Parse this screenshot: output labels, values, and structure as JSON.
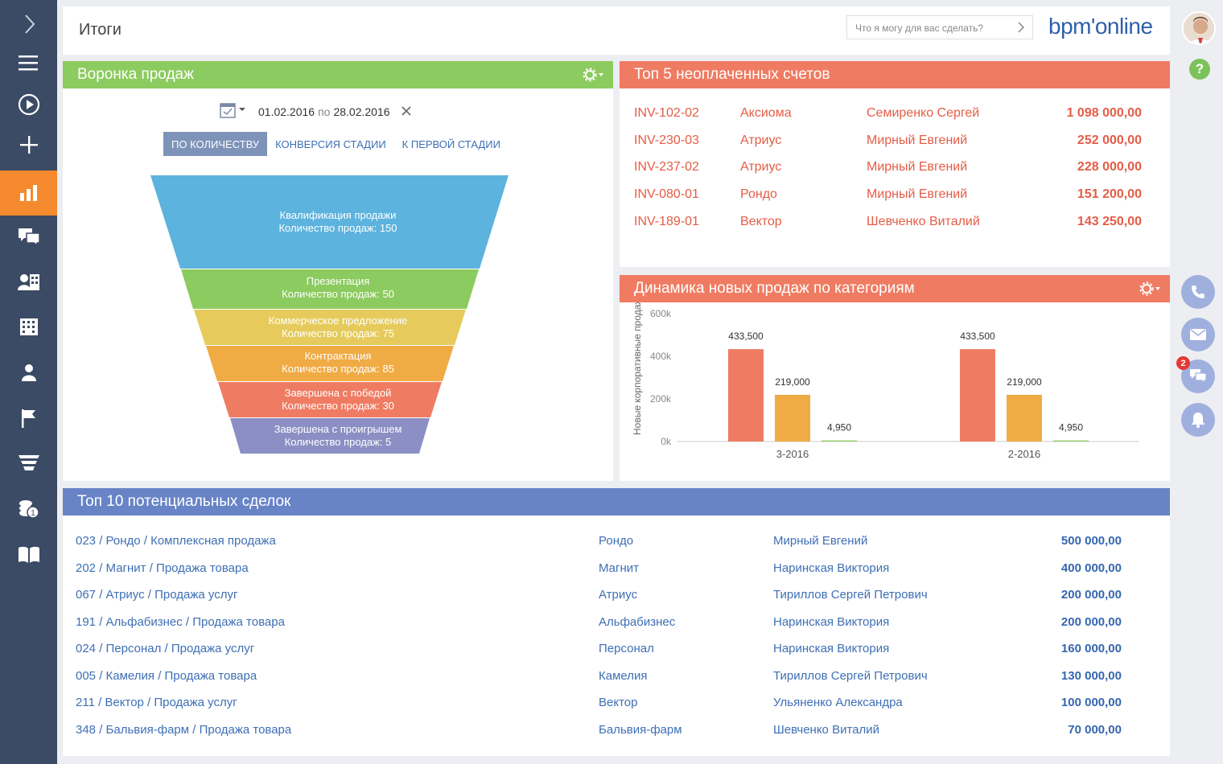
{
  "header": {
    "title": "Итоги",
    "search_placeholder": "Что я могу для вас сделать?",
    "logo": "bpm'online"
  },
  "sidebar": {
    "items": [
      {
        "icon": "chevron-right-icon"
      },
      {
        "icon": "menu-icon"
      },
      {
        "icon": "play-icon"
      },
      {
        "icon": "plus-icon"
      },
      {
        "icon": "analytics-icon",
        "active": true
      },
      {
        "icon": "feed-icon"
      },
      {
        "icon": "contacts-icon"
      },
      {
        "icon": "accounts-icon"
      },
      {
        "icon": "user-icon"
      },
      {
        "icon": "flag-icon"
      },
      {
        "icon": "funnel-icon"
      },
      {
        "icon": "coins-icon"
      },
      {
        "icon": "book-icon"
      }
    ]
  },
  "right_bar": {
    "help": "?",
    "chat_badge": "2"
  },
  "funnel": {
    "title": "Воронка продаж",
    "date_from": "01.02.2016",
    "date_sep": "по",
    "date_to": "28.02.2016",
    "tabs": [
      "ПО КОЛИЧЕСТВУ",
      "КОНВЕРСИЯ СТАДИИ",
      "К ПЕРВОЙ СТАДИИ"
    ],
    "stages": [
      {
        "name": "Квалификация продажи",
        "count": "Количество продаж: 150",
        "color": "#5cb3de"
      },
      {
        "name": "Презентация",
        "count": "Количество продаж: 50",
        "color": "#8ccb5f"
      },
      {
        "name": "Коммерческое предложение",
        "count": "Количество продаж: 75",
        "color": "#e6cb5c"
      },
      {
        "name": "Контрактация",
        "count": "Количество продаж: 85",
        "color": "#f0ab45"
      },
      {
        "name": "Завершена с победой",
        "count": "Количество продаж: 30",
        "color": "#ef7c62"
      },
      {
        "name": "Завершена с проигрышем",
        "count": "Количество продаж: 5",
        "color": "#8b8fc4"
      }
    ]
  },
  "invoices": {
    "title": "Топ 5 неоплаченных счетов",
    "rows": [
      {
        "num": "INV-102-02",
        "account": "Аксиома",
        "contact": "Семиренко Сергей",
        "amount": "1 098 000,00"
      },
      {
        "num": "INV-230-03",
        "account": "Атриус",
        "contact": "Мирный Евгений",
        "amount": "252 000,00"
      },
      {
        "num": "INV-237-02",
        "account": "Атриус",
        "contact": "Мирный Евгений",
        "amount": "228 000,00"
      },
      {
        "num": "INV-080-01",
        "account": "Рондо",
        "contact": "Мирный Евгений",
        "amount": "151 200,00"
      },
      {
        "num": "INV-189-01",
        "account": "Вектор",
        "contact": "Шевченко Виталий",
        "amount": "143 250,00"
      }
    ]
  },
  "dynamics": {
    "title": "Динамика новых продаж по категориям"
  },
  "chart_data": {
    "type": "bar",
    "categories": [
      "3-2016",
      "2-2016"
    ],
    "series": [
      {
        "values": [
          433500,
          433500
        ],
        "labels": [
          "433,500",
          "433,500"
        ],
        "color": "#ef7c62"
      },
      {
        "values": [
          219000,
          219000
        ],
        "labels": [
          "219,000",
          "219,000"
        ],
        "color": "#f0ab45"
      },
      {
        "values": [
          4950,
          4950
        ],
        "labels": [
          "4,950",
          "4,950"
        ],
        "color": "#8ccb5f"
      }
    ],
    "ylabel": "Новые корпоративные продажи",
    "yticks": [
      "0k",
      "200k",
      "400k",
      "600k"
    ],
    "ylim": [
      0,
      600000
    ]
  },
  "deals": {
    "title": "Топ 10 потенциальных сделок",
    "rows": [
      {
        "name": "023 / Рондо / Комплексная продажа",
        "account": "Рондо",
        "owner": "Мирный Евгений",
        "amount": "500 000,00"
      },
      {
        "name": "202 / Магнит / Продажа товара",
        "account": "Магнит",
        "owner": "Наринская Виктория",
        "amount": "400 000,00"
      },
      {
        "name": "067 / Атриус / Продажа услуг",
        "account": "Атриус",
        "owner": "Тириллов Сергей Петрович",
        "amount": "200 000,00"
      },
      {
        "name": "191 / Альфабизнес / Продажа товара",
        "account": "Альфабизнес",
        "owner": "Наринская Виктория",
        "amount": "200 000,00"
      },
      {
        "name": "024 / Персонал / Продажа услуг",
        "account": "Персонал",
        "owner": "Наринская Виктория",
        "amount": "160 000,00"
      },
      {
        "name": "005 / Камелия / Продажа товара",
        "account": "Камелия",
        "owner": "Тириллов Сергей Петрович",
        "amount": "130 000,00"
      },
      {
        "name": "211 / Вектор / Продажа услуг",
        "account": "Вектор",
        "owner": "Ульяненко Александра",
        "amount": "100 000,00"
      },
      {
        "name": "348 / Бальвия-фарм / Продажа товара",
        "account": "Бальвия-фарм",
        "owner": "Шевченко Виталий",
        "amount": "70 000,00"
      }
    ]
  }
}
